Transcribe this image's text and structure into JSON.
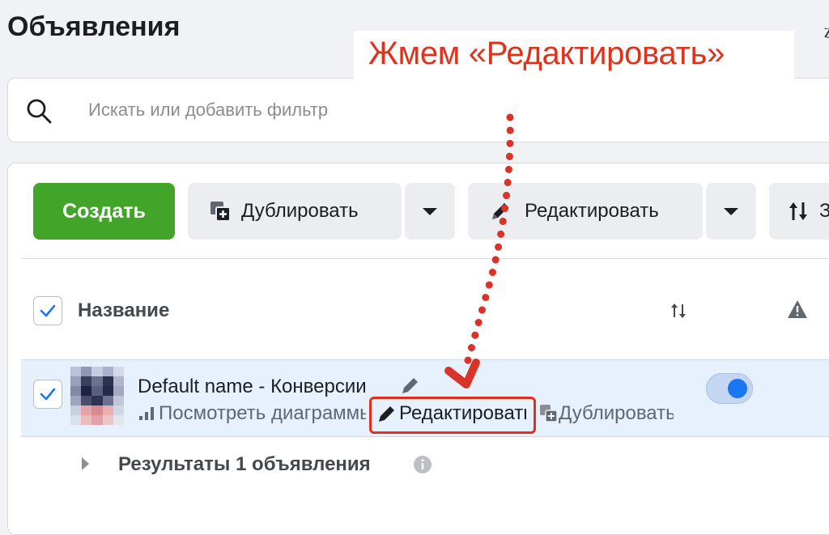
{
  "page": {
    "title": "Объявления",
    "corner_glyph": "ⲍ"
  },
  "search": {
    "placeholder": "Искать или добавить фильтр"
  },
  "annotation": {
    "text": "Жмем «Редактировать»",
    "color": "#e0311b"
  },
  "toolbar": {
    "create_label": "Создать",
    "duplicate_label": "Дублировать",
    "edit_label": "Редактировать",
    "sort_glyph": "З"
  },
  "table": {
    "column_name_label": "Название",
    "header_checkbox_checked": true,
    "rows": [
      {
        "name": "Default name - Конверсии",
        "checked": true,
        "active": true,
        "links": {
          "view_chart": "Посмотреть диаграммы",
          "edit": "Редактировать",
          "duplicate": "Дублировать"
        }
      }
    ],
    "results_label": "Результаты 1 объявления"
  },
  "colors": {
    "accent": "#1877f2",
    "create_button": "#42a429",
    "selected_row": "#e7f0fd",
    "highlight": "#e0311b"
  },
  "icons": {
    "search": "search-icon",
    "duplicate": "duplicate-icon",
    "edit": "pencil-icon",
    "dropdown": "caret-down-icon",
    "sort": "sort-icon",
    "warning": "warning-icon",
    "info": "info-icon",
    "chart": "bar-chart-icon"
  }
}
